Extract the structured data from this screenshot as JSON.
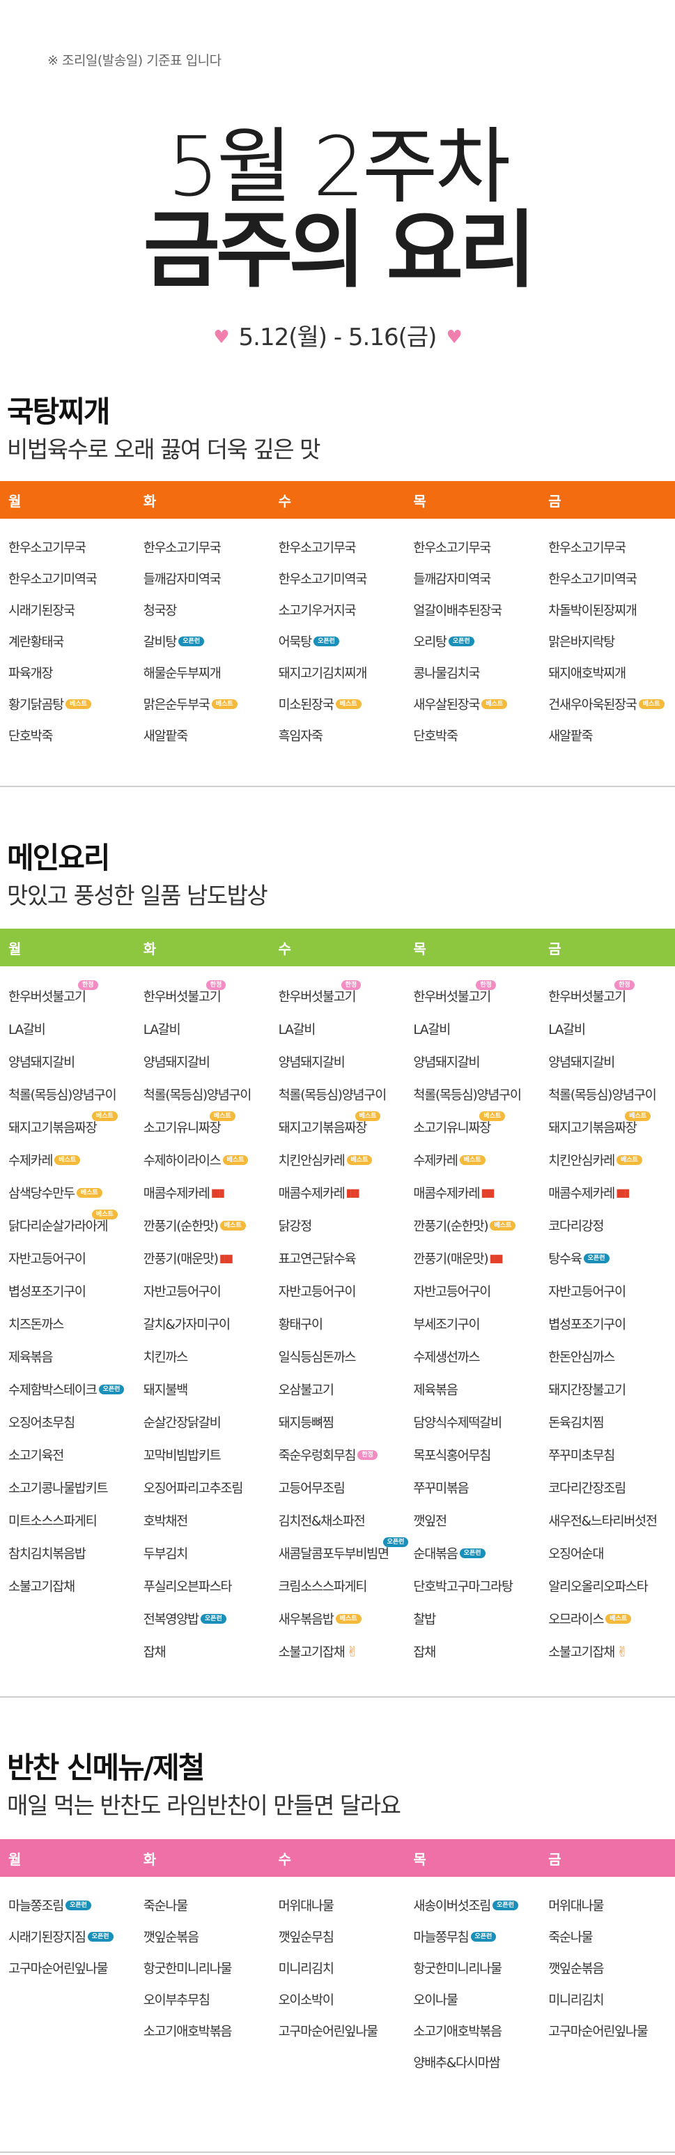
{
  "header": {
    "notice": "※ 조리일(발송일) 기준표 입니다",
    "week": "5월 2주차",
    "title": "금주의 요리",
    "date_range": "5.12(월) - 5.16(금)"
  },
  "colors": {
    "soup_bar": "#f36c0f",
    "main_bar": "#8dc63f",
    "side_bar": "#ef6fa7",
    "badge_blue": "#1a8fb9",
    "badge_yellow": "#f5b93b",
    "badge_pink": "#f28cc2"
  },
  "soup": {
    "title": "국탕찌개",
    "subtitle": "비법육수로 오래 끓여 더욱 깊은 맛",
    "days": [
      "월",
      "화",
      "수",
      "목",
      "금"
    ],
    "columns": [
      [
        "한우소고기무국",
        "한우소고기미역국",
        "시래기된장국",
        "계란황태국",
        "파육개장",
        "황기닭곰탕",
        "단호박죽"
      ],
      [
        "한우소고기무국",
        "들깨감자미역국",
        "청국장",
        "갈비탕",
        "해물순두부찌개",
        "맑은순두부국",
        "새알팥죽"
      ],
      [
        "한우소고기무국",
        "한우소고기미역국",
        "소고기우거지국",
        "어묵탕",
        "돼지고기김치찌개",
        "미소된장국",
        "흑임자죽"
      ],
      [
        "한우소고기무국",
        "들깨감자미역국",
        "얼갈이배추된장국",
        "오리탕",
        "콩나물김치국",
        "새우살된장국",
        "단호박죽"
      ],
      [
        "한우소고기무국",
        "한우소고기미역국",
        "차돌박이된장찌개",
        "맑은바지락탕",
        "돼지애호박찌개",
        "건새우아욱된장국",
        "새알팥죽"
      ]
    ]
  },
  "main": {
    "title": "메인요리",
    "subtitle": "맛있고 풍성한 일품 남도밥상",
    "days": [
      "월",
      "화",
      "수",
      "목",
      "금"
    ],
    "columns": [
      [
        "한우버섯불고기",
        "LA갈비",
        "양념돼지갈비",
        "척롤(목등심)양념구이",
        "돼지고기볶음짜장",
        "수제카레",
        "삼색당수만두",
        "닭다리순살가라아게",
        "자반고등어구이",
        "볍성포조기구이",
        "치즈돈까스",
        "제육볶음",
        "수제함박스테이크",
        "오징어초무침",
        "소고기육전",
        "소고기콩나물밥키트",
        "미트소스스파게티",
        "참치김치볶음밥",
        "소불고기잡채"
      ],
      [
        "한우버섯불고기",
        "LA갈비",
        "양념돼지갈비",
        "척롤(목등심)양념구이",
        "소고기유니짜장",
        "수제하이라이스",
        "매콤수제카레",
        "깐풍기(순한맛)",
        "깐풍기(매운맛)",
        "자반고등어구이",
        "갈치&가자미구이",
        "치킨까스",
        "돼지불백",
        "순살간장닭갈비",
        "꼬막비빔밥키트",
        "오징어파리고추조림",
        "호박채전",
        "두부김치",
        "푸실리오븐파스타",
        "전복영양밥",
        "잡채"
      ],
      [
        "한우버섯불고기",
        "LA갈비",
        "양념돼지갈비",
        "척롤(목등심)양념구이",
        "돼지고기볶음짜장",
        "치킨안심카레",
        "매콤수제카레",
        "닭강정",
        "표고연근닭수육",
        "자반고등어구이",
        "황태구이",
        "일식등심돈까스",
        "오삼불고기",
        "돼지등뼈찜",
        "죽순우렁회무침",
        "고등어무조림",
        "김치전&채소파전",
        "새콤달콤포두부비빔면",
        "크림소스스파게티",
        "새우볶음밥",
        "소불고기잡채"
      ],
      [
        "한우버섯불고기",
        "LA갈비",
        "양념돼지갈비",
        "척롤(목등심)양념구이",
        "소고기유니짜장",
        "수제카레",
        "매콤수제카레",
        "깐풍기(순한맛)",
        "깐풍기(매운맛)",
        "자반고등어구이",
        "부세조기구이",
        "수제생선까스",
        "제육볶음",
        "담양식수제떡갈비",
        "목포식홍어무침",
        "쭈꾸미볶음",
        "깻잎전",
        "순대볶음",
        "단호박고구마그라탕",
        "찰밥",
        "잡채"
      ],
      [
        "한우버섯불고기",
        "LA갈비",
        "양념돼지갈비",
        "척롤(목등심)양념구이",
        "돼지고기볶음짜장",
        "치킨안심카레",
        "매콤수제카레",
        "코다리강정",
        "탕수육",
        "자반고등어구이",
        "볍성포조기구이",
        "한돈안심까스",
        "돼지간장불고기",
        "돈육김치찜",
        "쭈꾸미초무침",
        "코다리간장조림",
        "새우전&느타리버섯전",
        "오징어순대",
        "알리오올리오파스타",
        "오므라이스",
        "소불고기잡채"
      ]
    ]
  },
  "side": {
    "title": "반찬 신메뉴/제철",
    "subtitle": "매일 먹는 반찬도 라임반찬이 만들면 달라요",
    "days": [
      "월",
      "화",
      "수",
      "목",
      "금"
    ],
    "columns": [
      [
        "마늘쫑조림",
        "시래기된장지짐",
        "고구마순어린잎나물"
      ],
      [
        "죽순나물",
        "깻잎순볶음",
        "항굿한미니리나물",
        "오이부추무침",
        "소고기애호박볶음"
      ],
      [
        "머위대나물",
        "깻잎순무침",
        "미니리김치",
        "오이소박이",
        "고구마순어린잎나물"
      ],
      [
        "새송이버섯조림",
        "마늘쫑무침",
        "항굿한미니리나물",
        "오이나물",
        "소고기애호박볶음",
        "양배추&다시마쌈"
      ],
      [
        "머위대나물",
        "죽순나물",
        "깻잎순볶음",
        "미니리김치",
        "고구마순어린잎나물"
      ]
    ]
  },
  "badges": {
    "new": "오픈런",
    "best": "베스트",
    "limited": "한정"
  }
}
